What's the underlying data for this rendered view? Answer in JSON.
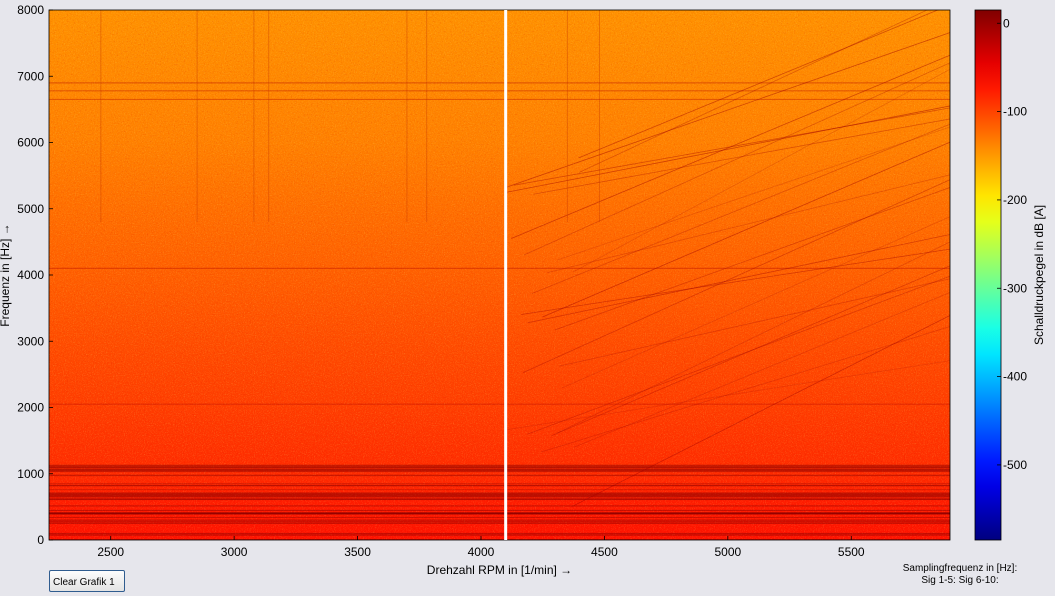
{
  "chart_data": {
    "type": "heatmap",
    "title": "",
    "xlabel": "Drehzahl RPM in [1/min] →",
    "ylabel": "Frequenz in [Hz] →",
    "xlim": [
      2250,
      5900
    ],
    "ylim": [
      0,
      8000
    ],
    "x_ticks": [
      2500,
      3000,
      3500,
      4000,
      4500,
      5000,
      5500
    ],
    "y_ticks": [
      0,
      1000,
      2000,
      3000,
      4000,
      5000,
      6000,
      7000,
      8000
    ],
    "marker_x": 4100,
    "colorbar": {
      "label": "Schalldruckpegel in dB [A]",
      "range": [
        -585,
        15
      ],
      "ticks": [
        0,
        -100,
        -200,
        -300,
        -400,
        -500
      ],
      "colormap": "jet"
    },
    "level_profile": {
      "frequency_hz": [
        0,
        500,
        1000,
        2000,
        3000,
        4000,
        5000,
        6000,
        7000,
        8000
      ],
      "level_db": [
        -70,
        -75,
        -85,
        -95,
        -105,
        -115,
        -125,
        -135,
        -140,
        -145
      ]
    }
  },
  "controls": {
    "clear_button": "Clear Grafik 1"
  },
  "sampling": {
    "label": "Samplingfrequenz in [Hz]:",
    "channels": "Sig 1-5:   Sig 6-10:"
  }
}
